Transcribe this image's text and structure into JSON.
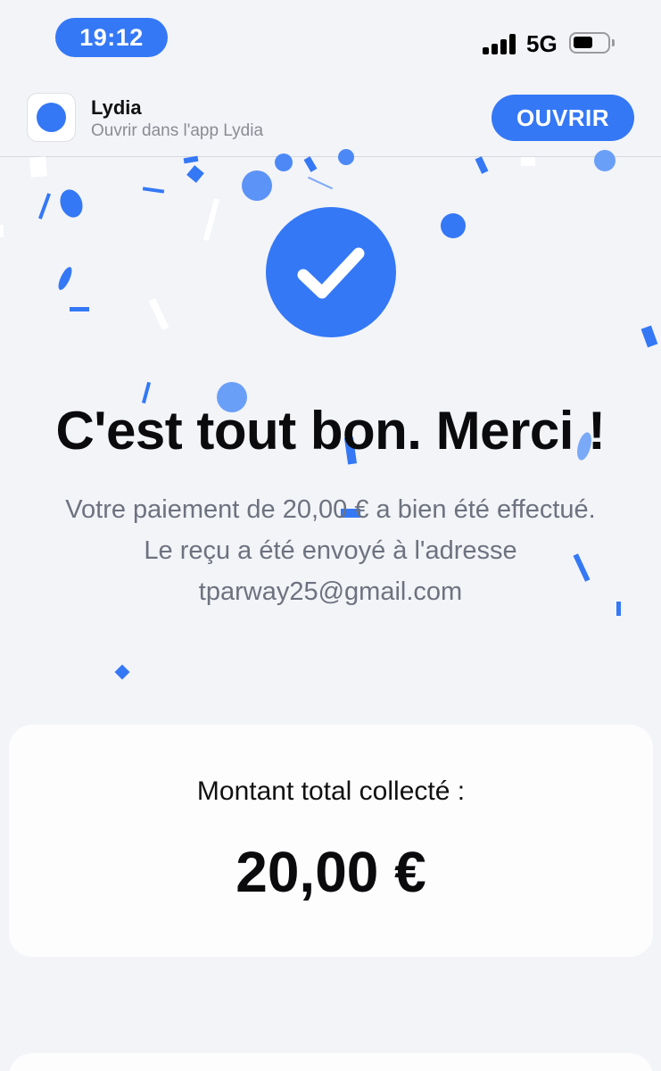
{
  "status_bar": {
    "time": "19:12",
    "network": "5G"
  },
  "app_banner": {
    "name": "Lydia",
    "subtitle": "Ouvrir dans l'app Lydia",
    "open_label": "OUVRIR"
  },
  "confirmation": {
    "headline": "C'est tout bon. Merci !",
    "message_line1": "Votre paiement de 20,00 € a bien été effectué.",
    "message_line2": "Le reçu a été envoyé à l'adresse",
    "email": "tparway25@gmail.com"
  },
  "total_card": {
    "label": "Montant total collecté :",
    "amount": "20,00 €"
  },
  "colors": {
    "accent": "#3478f6",
    "background": "#f3f4f8",
    "card": "#fdfdfe"
  }
}
